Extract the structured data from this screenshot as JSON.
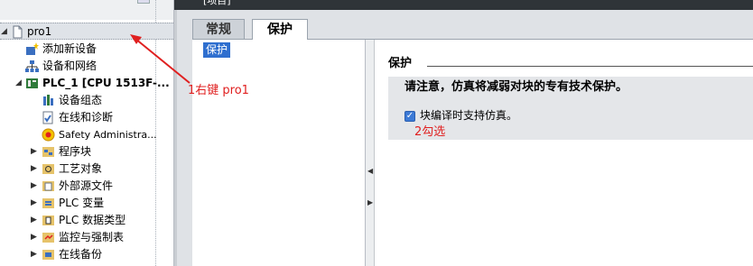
{
  "tree": {
    "items": [
      {
        "label": "pro1",
        "icon": "project-document-icon",
        "expander": "expanded"
      },
      {
        "label": "添加新设备",
        "icon": "add-device-icon",
        "expander": ""
      },
      {
        "label": "设备和网络",
        "icon": "network-icon",
        "expander": ""
      },
      {
        "label": "PLC_1 [CPU 1513F-...",
        "icon": "plc-icon",
        "expander": "expanded"
      },
      {
        "label": "设备组态",
        "icon": "device-config-icon",
        "expander": ""
      },
      {
        "label": "在线和诊断",
        "icon": "diagnostics-icon",
        "expander": ""
      },
      {
        "label": "Safety Administra...",
        "icon": "safety-icon",
        "expander": ""
      },
      {
        "label": "程序块",
        "icon": "program-blocks-icon",
        "expander": "collapsed"
      },
      {
        "label": "工艺对象",
        "icon": "technology-objects-icon",
        "expander": "collapsed"
      },
      {
        "label": "外部源文件",
        "icon": "external-source-icon",
        "expander": "collapsed"
      },
      {
        "label": "PLC 变量",
        "icon": "plc-tags-icon",
        "expander": "collapsed"
      },
      {
        "label": "PLC 数据类型",
        "icon": "plc-datatypes-icon",
        "expander": "collapsed"
      },
      {
        "label": "监控与强制表",
        "icon": "watch-tables-icon",
        "expander": "collapsed"
      },
      {
        "label": "在线备份",
        "icon": "online-backup-icon",
        "expander": "collapsed"
      }
    ]
  },
  "editor": {
    "title_fragment": "[项目]",
    "tabs": [
      {
        "label": "常规",
        "active": false
      },
      {
        "label": "保护",
        "active": true
      }
    ],
    "nav_item": "保护",
    "section_title": "保护",
    "note": "请注意，仿真将减弱对块的专有技术保护。",
    "checkbox_label": "块编译时支持仿真。",
    "checkbox_checked": true
  },
  "annotations": {
    "step1": "1右键 pro1",
    "step2": "2勾选",
    "color": "#e02020"
  }
}
